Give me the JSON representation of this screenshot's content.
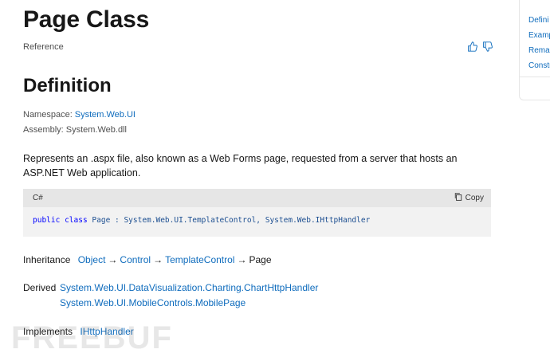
{
  "header": {
    "title": "Page Class",
    "subtitle": "Reference"
  },
  "definition": {
    "heading": "Definition",
    "namespace_label": "Namespace:",
    "namespace_value": "System.Web.UI",
    "assembly_label": "Assembly:",
    "assembly_value": "System.Web.dll",
    "description": "Represents an .aspx file, also known as a Web Forms page, requested from a server that hosts an ASP.NET Web application."
  },
  "code": {
    "language": "C#",
    "copy_label": "Copy",
    "kw1": "public",
    "kw2": "class",
    "rest": "Page : System.Web.UI.TemplateControl, System.Web.IHttpHandler"
  },
  "inheritance": {
    "label": "Inheritance",
    "items": [
      "Object",
      "Control",
      "TemplateControl"
    ],
    "current": "Page"
  },
  "derived": {
    "label": "Derived",
    "items": [
      "System.Web.UI.DataVisualization.Charting.ChartHttpHandler",
      "System.Web.UI.MobileControls.MobilePage"
    ]
  },
  "implements": {
    "label": "Implements",
    "items": [
      "IHttpHandler"
    ]
  },
  "toc": {
    "items": [
      "Defini",
      "Examp",
      "Remar",
      "Constr"
    ]
  },
  "watermark": "FREEBUF",
  "colors": {
    "link": "#0f6cbd",
    "code_bg": "#f2f2f2",
    "code_head_bg": "#e6e6e6"
  }
}
